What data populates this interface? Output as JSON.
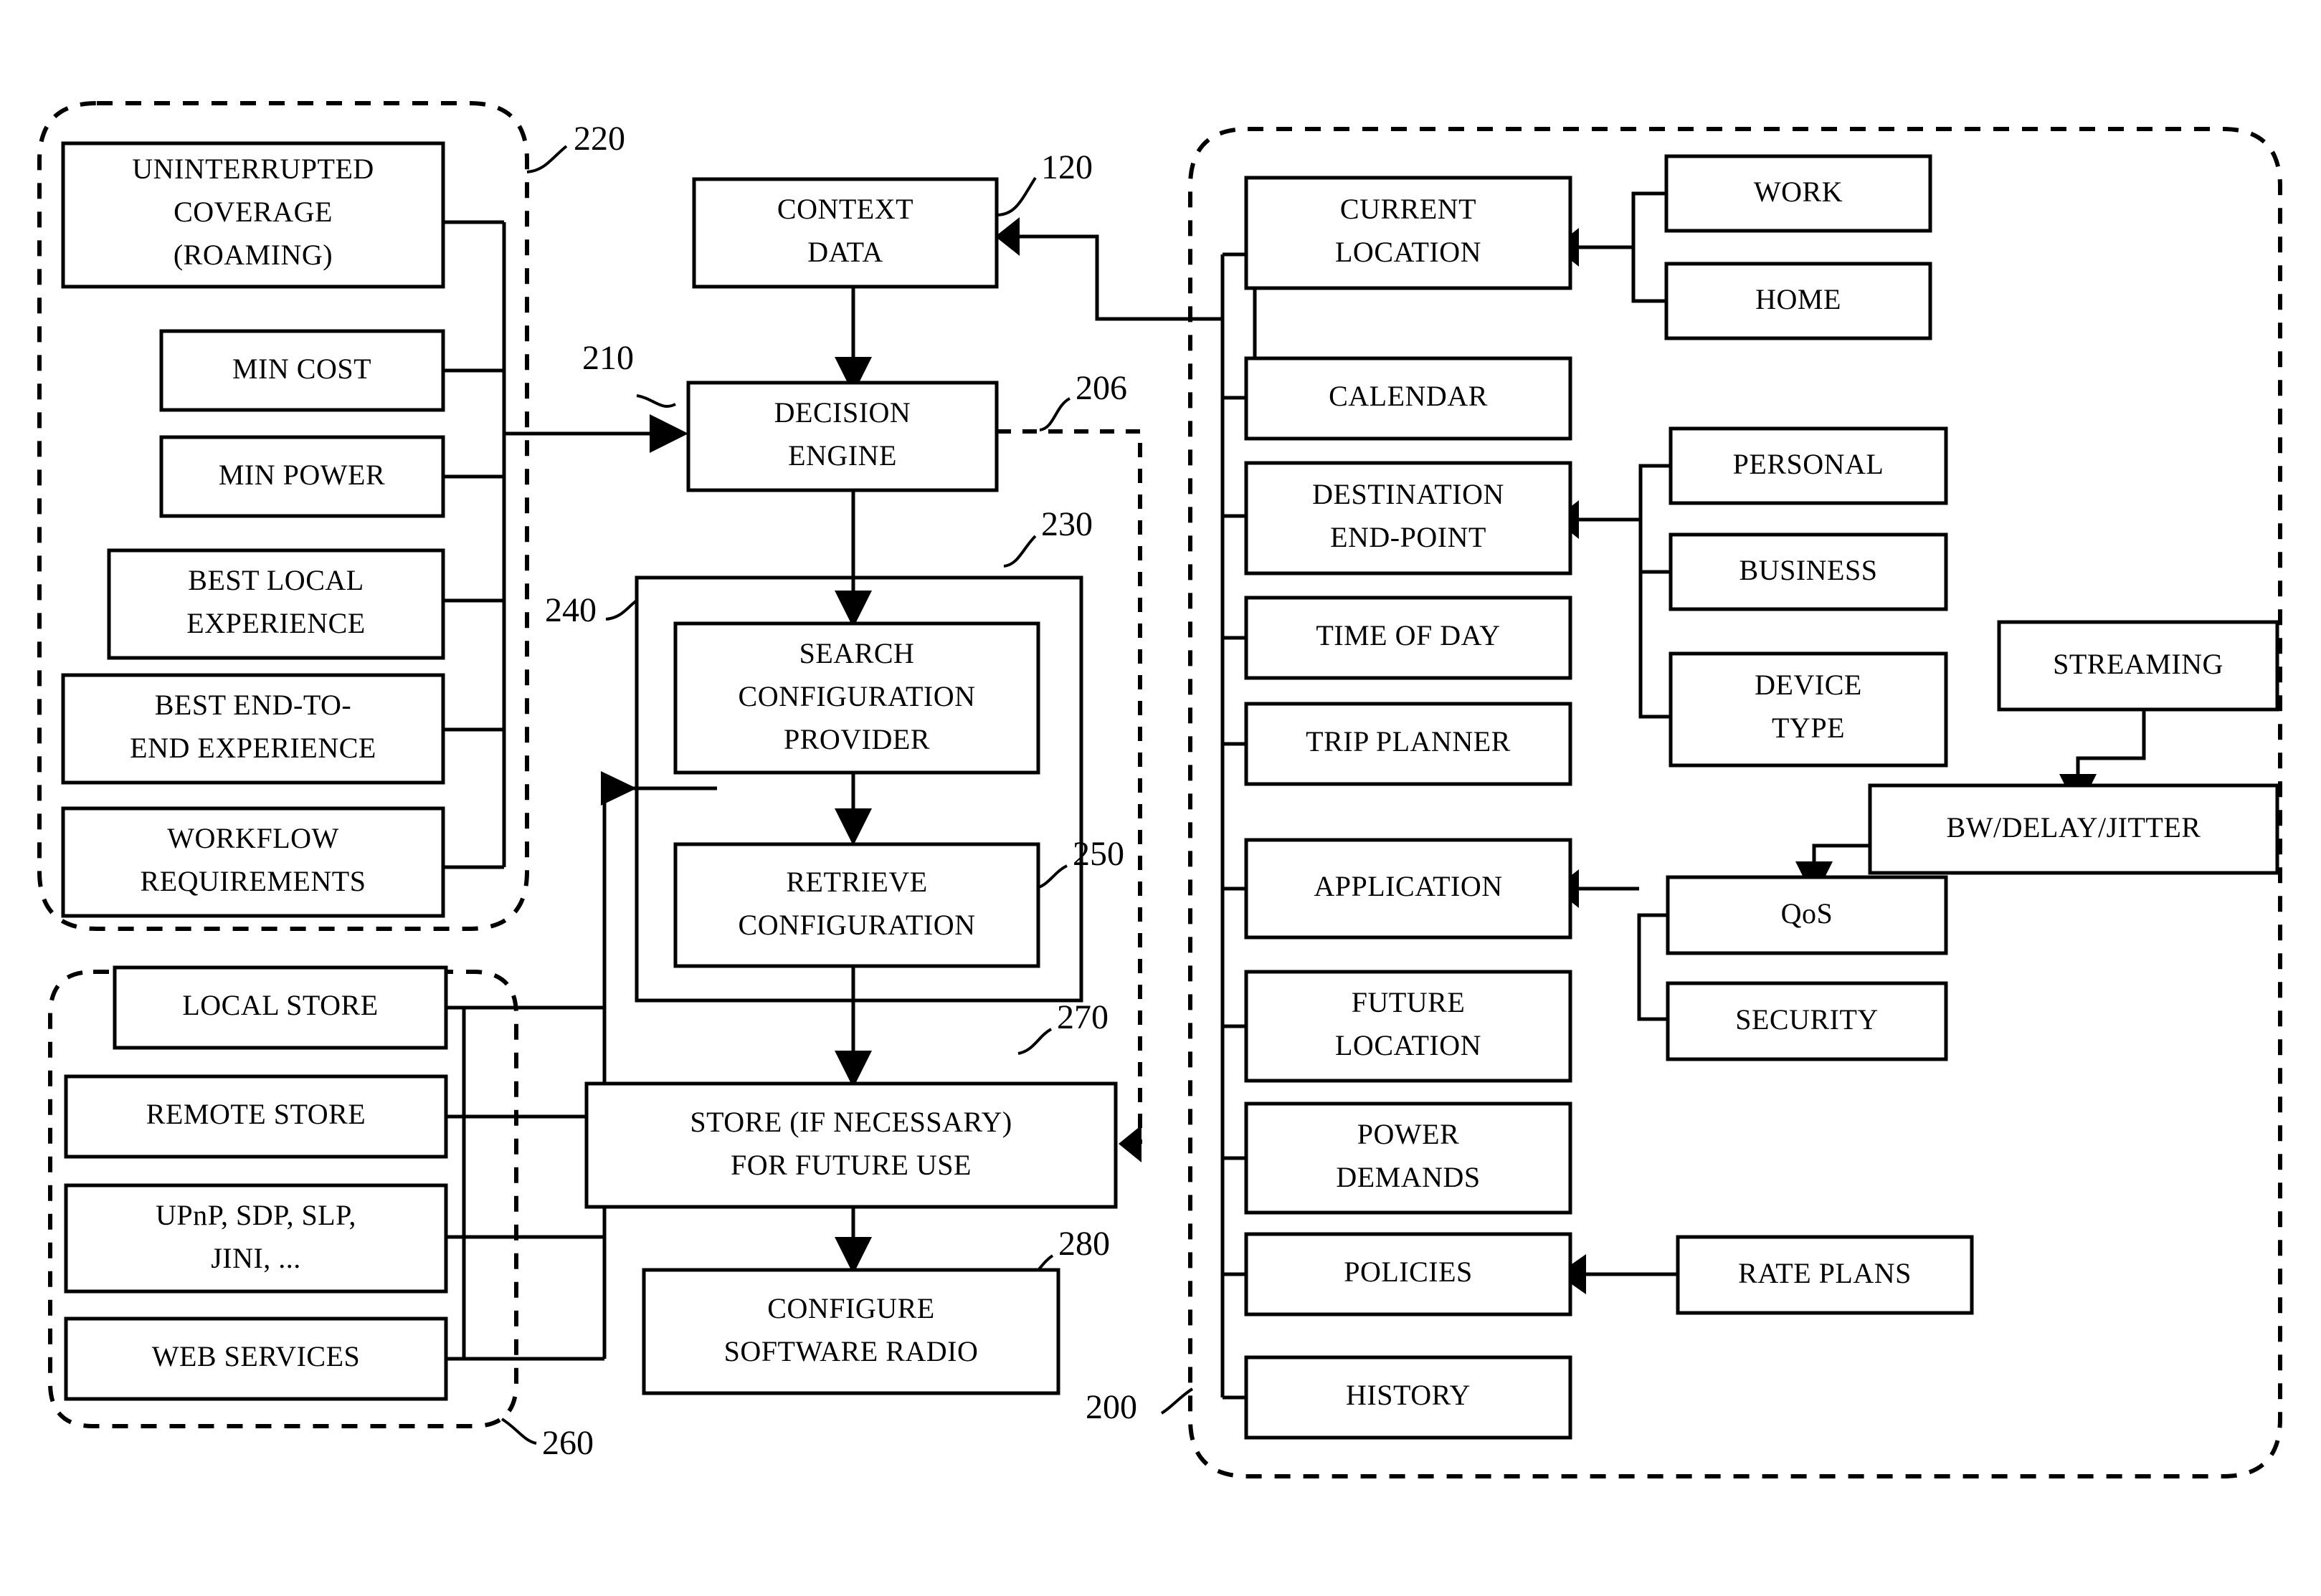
{
  "figure": {
    "type": "patent-block-diagram",
    "title": "",
    "reference_numerals": [
      {
        "id": "ref-220",
        "label": "220"
      },
      {
        "id": "ref-120",
        "label": "120"
      },
      {
        "id": "ref-210",
        "label": "210"
      },
      {
        "id": "ref-206",
        "label": "206"
      },
      {
        "id": "ref-230",
        "label": "230"
      },
      {
        "id": "ref-240",
        "label": "240"
      },
      {
        "id": "ref-250",
        "label": "250"
      },
      {
        "id": "ref-270",
        "label": "270"
      },
      {
        "id": "ref-280",
        "label": "280"
      },
      {
        "id": "ref-260",
        "label": "260"
      },
      {
        "id": "ref-200",
        "label": "200"
      }
    ]
  },
  "policy_group": {
    "ref": "220",
    "items": [
      {
        "lines": [
          "UNINTERRUPTED",
          "COVERAGE",
          "(ROAMING)"
        ]
      },
      {
        "lines": [
          "MIN COST"
        ]
      },
      {
        "lines": [
          "MIN POWER"
        ]
      },
      {
        "lines": [
          "BEST LOCAL",
          "EXPERIENCE"
        ]
      },
      {
        "lines": [
          "BEST END-TO-",
          "END EXPERIENCE"
        ]
      },
      {
        "lines": [
          "WORKFLOW",
          "REQUIREMENTS"
        ]
      }
    ]
  },
  "provider_group": {
    "ref": "260",
    "items": [
      {
        "lines": [
          "LOCAL STORE"
        ]
      },
      {
        "lines": [
          "REMOTE STORE"
        ]
      },
      {
        "lines": [
          "UPnP, SDP, SLP,",
          "JINI, ..."
        ]
      },
      {
        "lines": [
          "WEB SERVICES"
        ]
      }
    ]
  },
  "pipeline": {
    "context_data": {
      "ref": "120",
      "lines": [
        "CONTEXT",
        "DATA"
      ]
    },
    "decision_engine": {
      "ref": "210",
      "lines": [
        "DECISION",
        "ENGINE"
      ]
    },
    "search_configuration_provider": {
      "ref": "230",
      "lines": [
        "SEARCH",
        "CONFIGURATION",
        "PROVIDER"
      ]
    },
    "retrieve_configuration": {
      "ref": "250",
      "lines": [
        "RETRIEVE",
        "CONFIGURATION"
      ]
    },
    "store_for_future_use": {
      "ref": "270",
      "lines": [
        "STORE (IF NECESSARY)",
        "FOR FUTURE USE"
      ]
    },
    "configure_software_radio": {
      "ref": "280",
      "lines": [
        "CONFIGURE",
        "SOFTWARE RADIO"
      ]
    },
    "outer_container_ref": "240"
  },
  "context_group": {
    "ref": "200",
    "items": [
      {
        "lines": [
          "CURRENT",
          "LOCATION"
        ]
      },
      {
        "lines": [
          "CALENDAR"
        ]
      },
      {
        "lines": [
          "DESTINATION",
          "END-POINT"
        ]
      },
      {
        "lines": [
          "TIME OF DAY"
        ]
      },
      {
        "lines": [
          "TRIP PLANNER"
        ]
      },
      {
        "lines": [
          "APPLICATION"
        ]
      },
      {
        "lines": [
          "FUTURE",
          "LOCATION"
        ]
      },
      {
        "lines": [
          "POWER",
          "DEMANDS"
        ]
      },
      {
        "lines": [
          "POLICIES"
        ]
      },
      {
        "lines": [
          "HISTORY"
        ]
      }
    ],
    "location_sources": [
      {
        "lines": [
          "WORK"
        ]
      },
      {
        "lines": [
          "HOME"
        ]
      }
    ],
    "endpoint_sources": [
      {
        "lines": [
          "PERSONAL"
        ]
      },
      {
        "lines": [
          "BUSINESS"
        ]
      },
      {
        "lines": [
          "DEVICE",
          "TYPE"
        ]
      }
    ],
    "application_sources": [
      {
        "lines": [
          "QoS"
        ]
      },
      {
        "lines": [
          "SECURITY"
        ]
      }
    ],
    "qos_chain": [
      {
        "lines": [
          "STREAMING"
        ]
      },
      {
        "lines": [
          "BW/DELAY/JITTER"
        ]
      }
    ],
    "policy_sources": [
      {
        "lines": [
          "RATE PLANS"
        ]
      }
    ]
  },
  "colors": {
    "ink": "#000000",
    "paper": "#ffffff"
  }
}
